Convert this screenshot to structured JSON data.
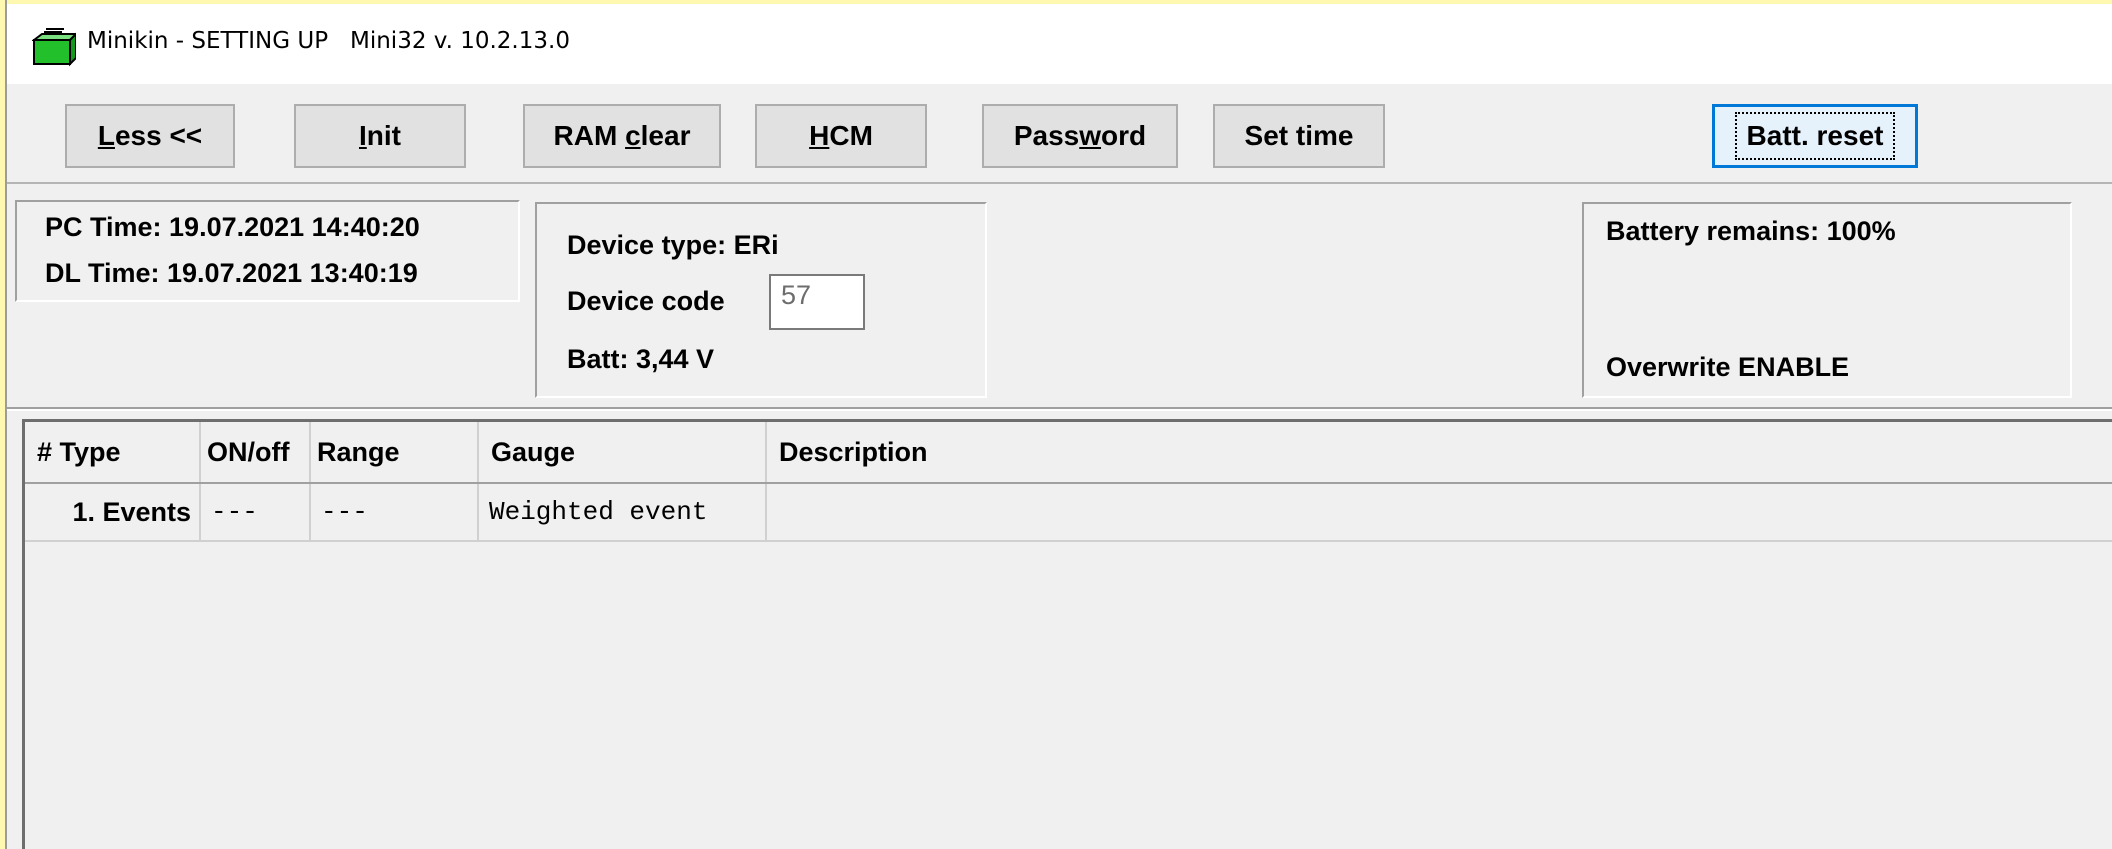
{
  "window": {
    "title": "Minikin - SETTING UP   Mini32 v. 10.2.13.0",
    "icon": "folder-green-icon"
  },
  "toolbar": {
    "less_pre": "",
    "less_ul": "L",
    "less_post": "ess <<",
    "init_ul": "I",
    "init_post": "nit",
    "ramclear_pre": "RAM ",
    "ramclear_ul": "c",
    "ramclear_post": "lear",
    "hcm_ul": "H",
    "hcm_post": "CM",
    "password_pre": "Pass",
    "password_ul": "w",
    "password_post": "ord",
    "settime": "Set time",
    "battreset": "Batt. reset"
  },
  "info": {
    "pc_time": "PC Time: 19.07.2021 14:40:20",
    "dl_time": "DL Time: 19.07.2021 13:40:19",
    "device_type": "Device type: ERi",
    "device_code_label": "Device code",
    "device_code_value": "57",
    "batt": "Batt: 3,44 V",
    "battery_remains": "Battery remains: 100%",
    "overwrite": "Overwrite ENABLE"
  },
  "table": {
    "headers": [
      "# Type",
      "ON/off",
      "Range",
      "Gauge",
      "Description"
    ],
    "rows": [
      [
        "1. Events",
        "---",
        "---",
        "Weighted event",
        ""
      ]
    ]
  },
  "colors": {
    "focus_border": "#0078d7",
    "icon_green": "#2ecc40"
  }
}
